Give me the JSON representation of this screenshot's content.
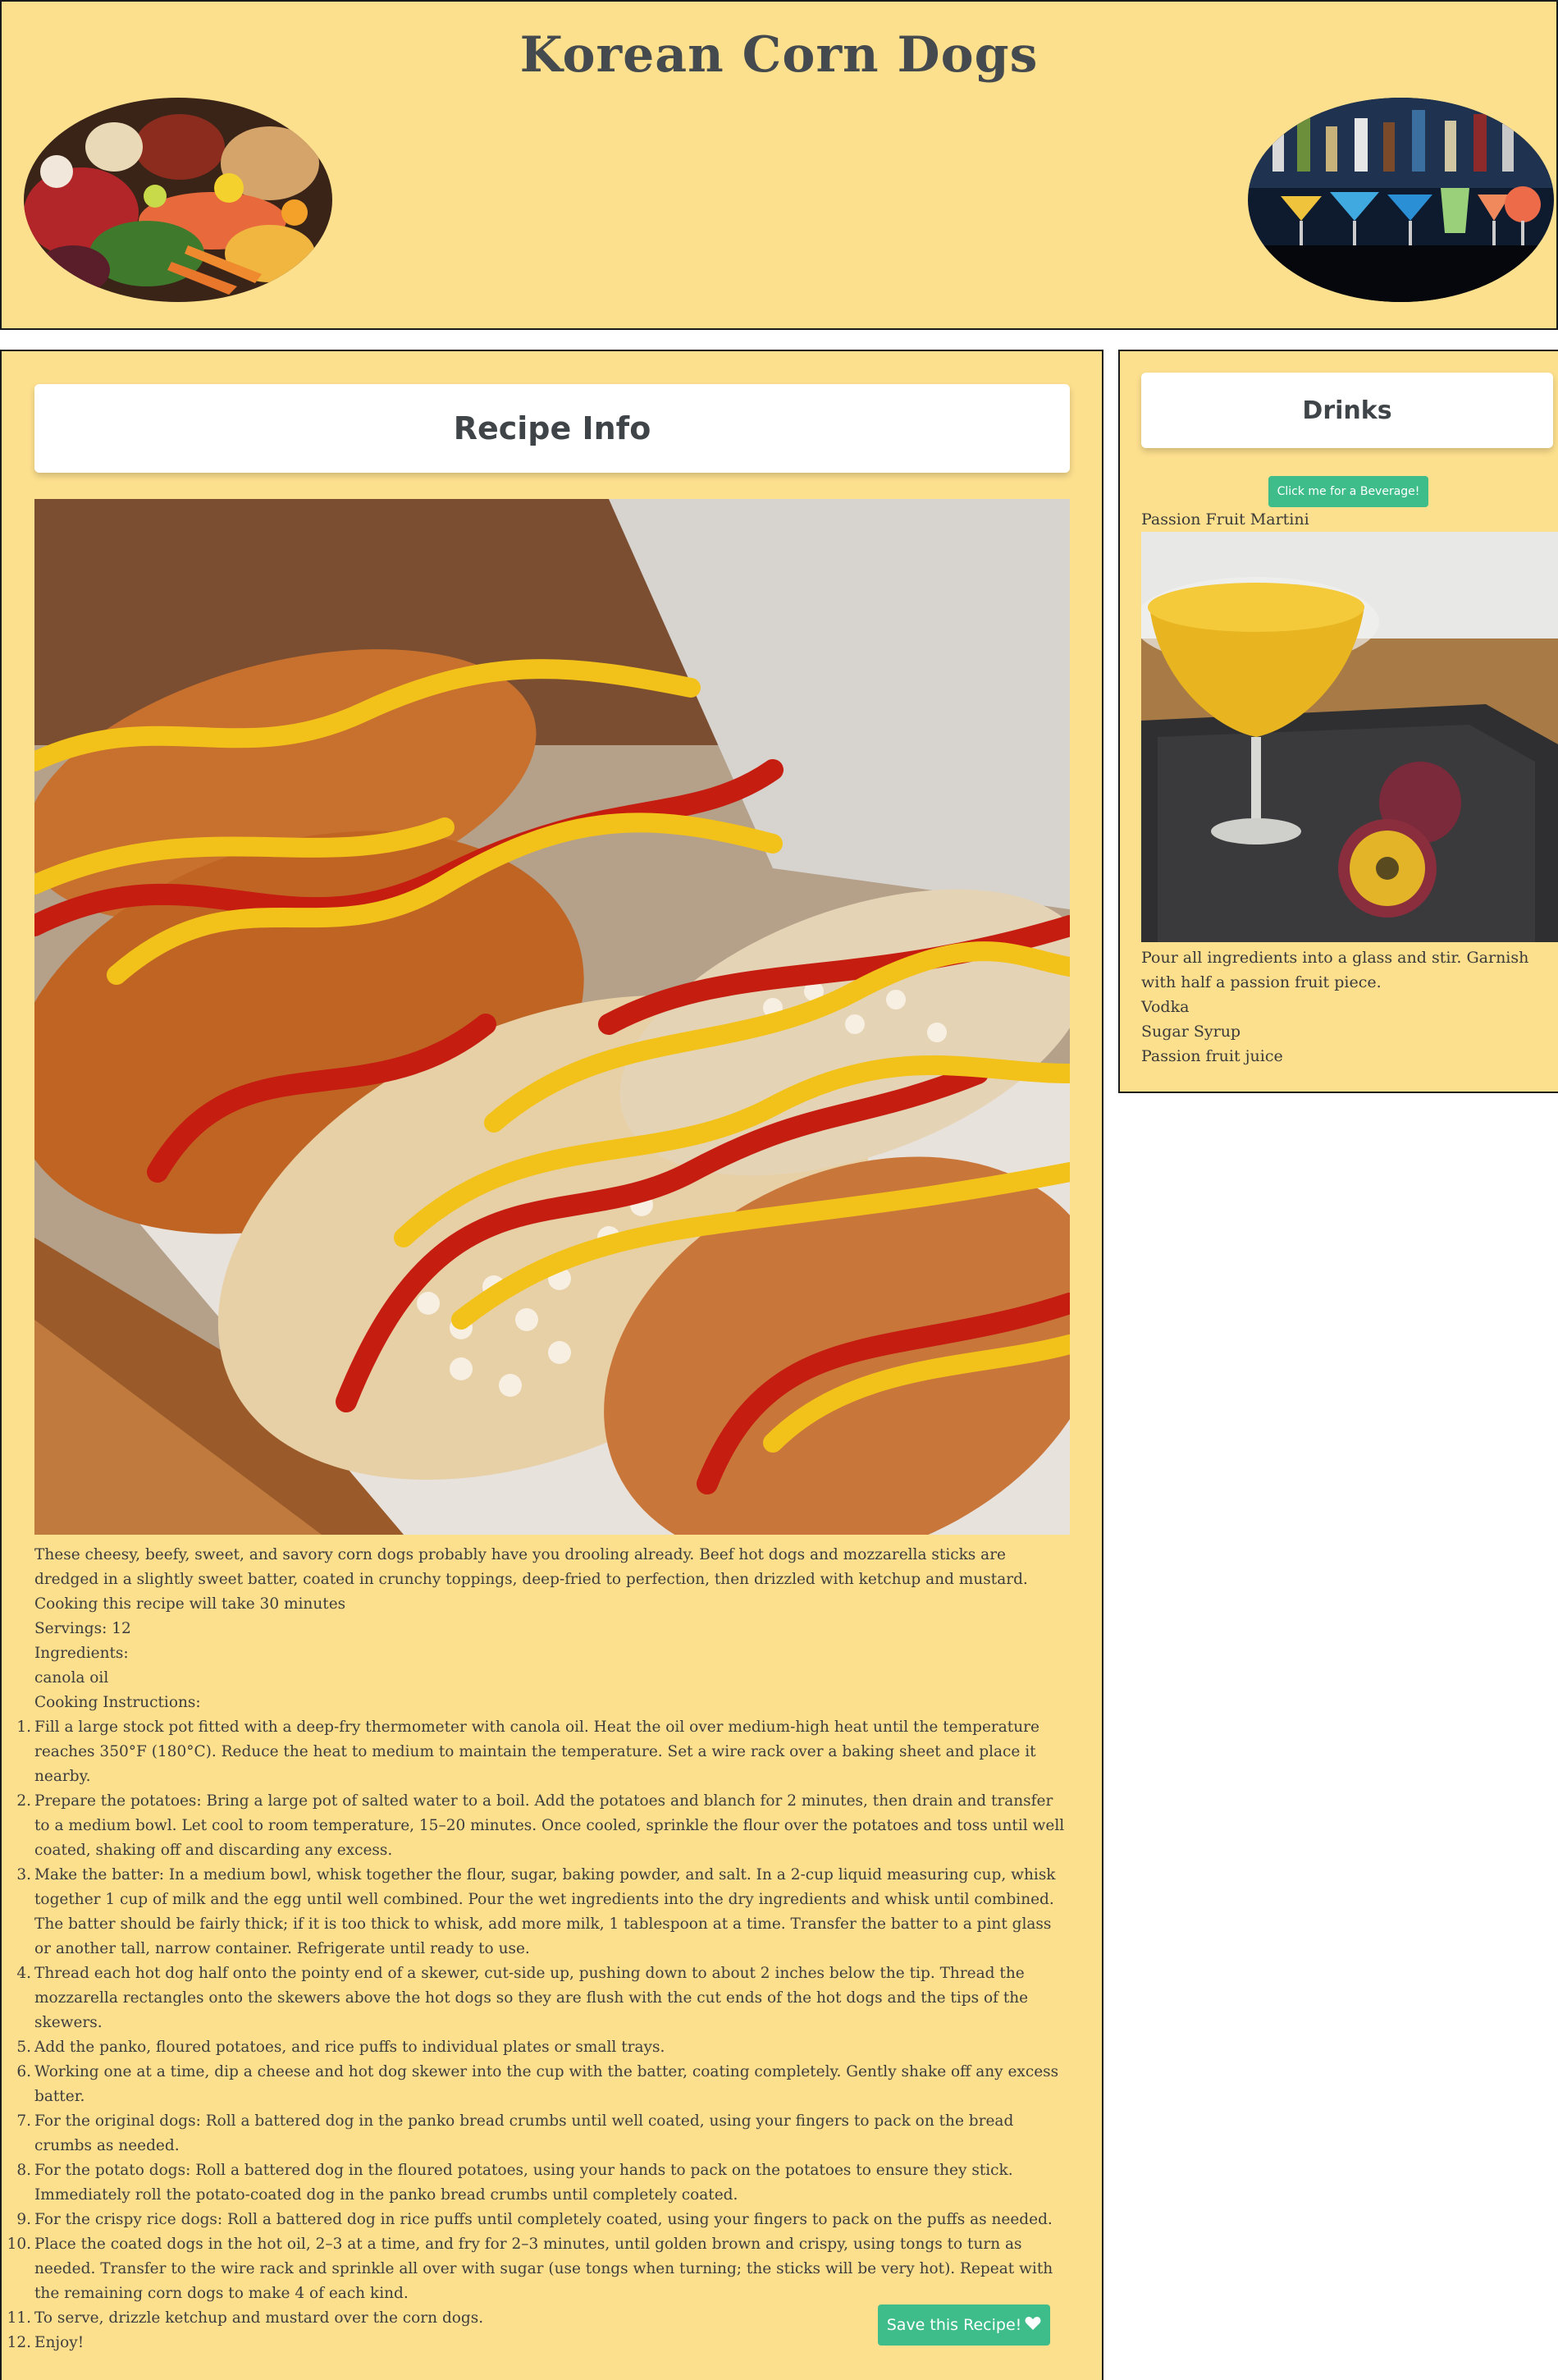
{
  "header": {
    "title": "Korean Corn Dogs"
  },
  "recipe": {
    "card_title": "Recipe Info",
    "description": "These cheesy, beefy, sweet, and savory corn dogs probably have you drooling already. Beef hot dogs and mozzarella sticks are dredged in a slightly sweet batter, coated in crunchy toppings, deep-fried to perfection, then drizzled with ketchup and mustard.",
    "cook_time": "Cooking this recipe will take 30 minutes",
    "servings": "Servings: 12",
    "ingredients_label": "Ingredients:",
    "ingredients": [
      "canola oil"
    ],
    "instructions_label": "Cooking Instructions:",
    "instructions": [
      "Fill a large stock pot fitted with a deep-fry thermometer with canola oil. Heat the oil over medium-high heat until the temperature reaches 350°F (180°C). Reduce the heat to medium to maintain the temperature. Set a wire rack over a baking sheet and place it nearby.",
      "Prepare the potatoes: Bring a large pot of salted water to a boil. Add the potatoes and blanch for 2 minutes, then drain and transfer to a medium bowl. Let cool to room temperature, 15–20 minutes. Once cooled, sprinkle the flour over the potatoes and toss until well coated, shaking off and discarding any excess.",
      "Make the batter: In a medium bowl, whisk together the flour, sugar, baking powder, and salt. In a 2-cup liquid measuring cup, whisk together 1 cup of milk and the egg until well combined. Pour the wet ingredients into the dry ingredients and whisk until combined. The batter should be fairly thick; if it is too thick to whisk, add more milk, 1 tablespoon at a time. Transfer the batter to a pint glass or another tall, narrow container. Refrigerate until ready to use.",
      "Thread each hot dog half onto the pointy end of a skewer, cut-side up, pushing down to about 2 inches below the tip. Thread the mozzarella rectangles onto the skewers above the hot dogs so they are flush with the cut ends of the hot dogs and the tips of the skewers.",
      "Add the panko, floured potatoes, and rice puffs to individual plates or small trays.",
      "Working one at a time, dip a cheese and hot dog skewer into the cup with the batter, coating completely. Gently shake off any excess batter.",
      "For the original dogs: Roll a battered dog in the panko bread crumbs until well coated, using your fingers to pack on the bread crumbs as needed.",
      "For the potato dogs: Roll a battered dog in the floured potatoes, using your hands to pack on the potatoes to ensure they stick. Immediately roll the potato-coated dog in the panko bread crumbs until completely coated.",
      "For the crispy rice dogs: Roll a battered dog in rice puffs until completely coated, using your fingers to pack on the puffs as needed.",
      "Place the coated dogs in the hot oil, 2–3 at a time, and fry for 2–3 minutes, until golden brown and crispy, using tongs to turn as needed. Transfer to the wire rack and sprinkle all over with sugar (use tongs when turning; the sticks will be very hot). Repeat with the remaining corn dogs to make 4 of each kind.",
      "To serve, drizzle ketchup and mustard over the corn dogs.",
      "Enjoy!"
    ],
    "save_button": "Save this Recipe!",
    "save_icon": "heart-icon"
  },
  "drinks": {
    "card_title": "Drinks",
    "button": "Click me for a Beverage!",
    "name": "Passion Fruit Martini",
    "instructions": "Pour all ingredients into a glass and stir. Garnish with half a passion fruit piece.",
    "ingredients": [
      "Vodka",
      "Sugar Syrup",
      "Passion fruit juice"
    ]
  },
  "colors": {
    "page_background": "#fde08e",
    "accent_button": "#3ebd8a",
    "border": "#1a1a1a",
    "title_text": "#444a4d"
  }
}
